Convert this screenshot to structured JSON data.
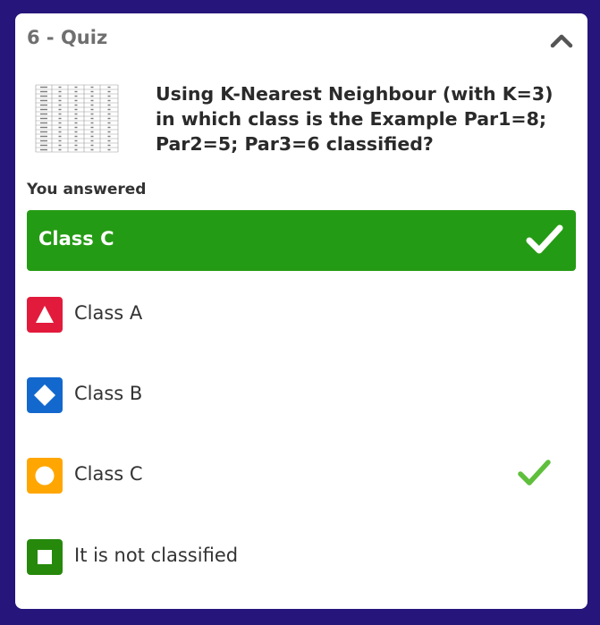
{
  "quiz": {
    "title": "6 - Quiz",
    "question": "Using K-Nearest Neighbour (with K=3) in which class is the Example Par1=8; Par2=5; Par3=6 classified?",
    "answered_label": "You answered",
    "selected_answer": "Class C",
    "correct_option": "Class C",
    "options": [
      {
        "label": "Class A",
        "shape": "triangle",
        "color": "#e21b3c"
      },
      {
        "label": "Class B",
        "shape": "diamond",
        "color": "#1368ce"
      },
      {
        "label": "Class C",
        "shape": "circle",
        "color": "#ffa602"
      },
      {
        "label": "It is not classified",
        "shape": "square",
        "color": "#26890c"
      }
    ]
  },
  "colors": {
    "background": "#26157a",
    "answer_bar": "#249b14",
    "check": "#5fbf3c"
  },
  "icons": {
    "collapse": "chevron-up-icon",
    "selected_check": "checkmark-icon",
    "correct_check": "checkmark-icon",
    "thumbnail": "data-table-thumbnail"
  }
}
